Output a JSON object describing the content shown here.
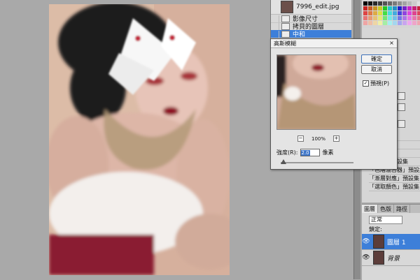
{
  "history": {
    "snapshot_name": "7996_edit.jpg",
    "steps": [
      {
        "label": "影像尺寸",
        "active": false
      },
      {
        "label": "拷貝的圖層",
        "active": false
      },
      {
        "label": "中和",
        "active": true
      }
    ]
  },
  "dialog": {
    "title": "高斯模糊",
    "close": "×",
    "ok_label": "確定",
    "cancel_label": "取消",
    "preview_label": "預視(P)",
    "preview_checked_mark": "✓",
    "zoom_minus": "−",
    "zoom_plus": "+",
    "zoom_level": "100%",
    "radius_label": "強度(R):",
    "radius_value": "2.0",
    "radius_unit": "像素",
    "slider_fraction": 0.04
  },
  "presets": [
    "預設集",
    "預設集",
    "預設集",
    "「黑白」預設集",
    "「色階混合器」預設集",
    "「漸層對應」預設集",
    "「選取顏色」預設集"
  ],
  "layers": {
    "tabs": [
      "圖層",
      "色版",
      "路徑"
    ],
    "blend_mode": "正常",
    "lock_label": "鎖定:",
    "rows": [
      {
        "name": "圖層 1",
        "active": true
      },
      {
        "name": "背景",
        "active": false
      }
    ]
  },
  "colors": {
    "selection": "#3d7fd9",
    "panel": "#d6d6d6",
    "workspace": "#a9a9a9"
  }
}
